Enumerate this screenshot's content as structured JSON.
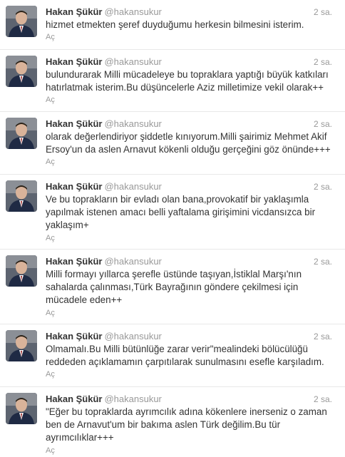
{
  "tweets": [
    {
      "name": "Hakan Şükür",
      "handle": "@hakansukur",
      "time": "2 sa.",
      "text": "hizmet etmekten şeref duyduğumu herkesin bilmesini isterim.",
      "action": "Aç"
    },
    {
      "name": "Hakan Şükür",
      "handle": "@hakansukur",
      "time": "2 sa.",
      "text": "bulundurarak Milli mücadeleye bu topraklara yaptığı büyük katkıları hatırlatmak isterim.Bu düşüncelerle Aziz milletimize vekil olarak++",
      "action": "Aç"
    },
    {
      "name": "Hakan Şükür",
      "handle": "@hakansukur",
      "time": "2 sa.",
      "text": "olarak değerlendiriyor şiddetle kınıyorum.Milli şairimiz Mehmet Akif Ersoy'un da aslen Arnavut kökenli olduğu gerçeğini göz önünde+++",
      "action": "Aç"
    },
    {
      "name": "Hakan Şükür",
      "handle": "@hakansukur",
      "time": "2 sa.",
      "text": "Ve bu toprakların bir evladı olan bana,provokatif bir yaklaşımla yapılmak istenen amacı belli yaftalama girişimini vicdansızca bir yaklaşım+",
      "action": "Aç"
    },
    {
      "name": "Hakan Şükür",
      "handle": "@hakansukur",
      "time": "2 sa.",
      "text": "Milli formayı yıllarca şerefle üstünde taşıyan,İstiklal Marşı'nın sahalarda çalınması,Türk Bayrağının göndere çekilmesi için mücadele eden++",
      "action": "Aç"
    },
    {
      "name": "Hakan Şükür",
      "handle": "@hakansukur",
      "time": "2 sa.",
      "text": "Olmamalı.Bu Milli bütünlüğe zarar verir\"mealindeki bölücülüğü reddeden açıklamamın çarpıtılarak sunulmasını esefle karşıladım.",
      "action": "Aç"
    },
    {
      "name": "Hakan Şükür",
      "handle": "@hakansukur",
      "time": "2 sa.",
      "text": "\"Eğer bu topraklarda ayrımcılık adına kökenlere inerseniz o zaman ben de Arnavut'um bir bakıma aslen Türk değilim.Bu tür ayrımcılıklar+++",
      "action": "Aç"
    }
  ]
}
